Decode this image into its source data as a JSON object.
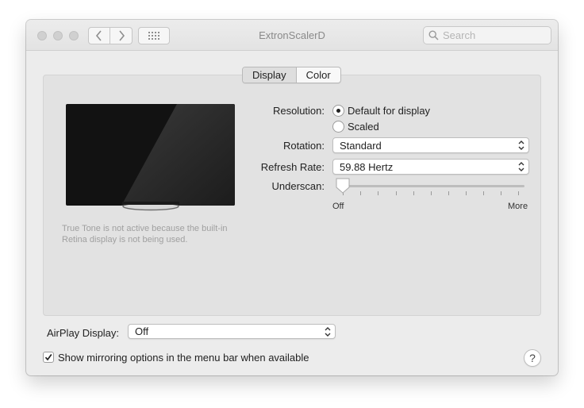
{
  "window": {
    "title": "ExtronScalerD"
  },
  "search": {
    "placeholder": "Search"
  },
  "tabs": [
    {
      "label": "Display",
      "selected": true
    },
    {
      "label": "Color",
      "selected": false
    }
  ],
  "true_tone_note": "True Tone is not active because the built-in Retina display is not being used.",
  "resolution": {
    "label": "Resolution:",
    "options": [
      {
        "label": "Default for display",
        "selected": true
      },
      {
        "label": "Scaled",
        "selected": false
      }
    ]
  },
  "rotation": {
    "label": "Rotation:",
    "value": "Standard"
  },
  "refresh_rate": {
    "label": "Refresh Rate:",
    "value": "59.88 Hertz"
  },
  "underscan": {
    "label": "Underscan:",
    "min_label": "Off",
    "max_label": "More",
    "value_fraction": 0.0
  },
  "airplay": {
    "label": "AirPlay Display:",
    "value": "Off"
  },
  "mirroring": {
    "label": "Show mirroring options in the menu bar when available",
    "checked": true
  },
  "help": {
    "label": "?"
  },
  "icons": [
    "back-chevron-icon",
    "forward-chevron-icon",
    "grid-icon",
    "search-icon",
    "up-down-chevron-icon",
    "checkmark-icon"
  ]
}
